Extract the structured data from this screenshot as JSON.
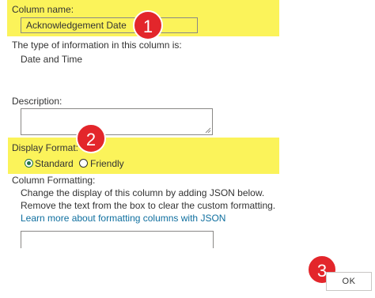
{
  "column_name": {
    "label": "Column name:",
    "value": "Acknowledgement Date"
  },
  "type_info": {
    "label": "The type of information in this column is:",
    "value": "Date and Time"
  },
  "description": {
    "label": "Description:",
    "value": ""
  },
  "display_format": {
    "label": "Display Format:",
    "options": [
      {
        "label": "Standard",
        "checked": true
      },
      {
        "label": "Friendly",
        "checked": false
      }
    ]
  },
  "column_formatting": {
    "label": "Column Formatting:",
    "help_line1": "Change the display of this column by adding JSON below.",
    "help_line2": "Remove the text from the box to clear the custom formatting.",
    "link_text": "Learn more about formatting columns with JSON",
    "value": ""
  },
  "callouts": [
    "1",
    "2",
    "3"
  ],
  "ok_button": "OK",
  "colors": {
    "highlight": "#fbf35a",
    "callout": "#e3262b",
    "link": "#0f6f9f",
    "radio_checked": "#217346"
  }
}
